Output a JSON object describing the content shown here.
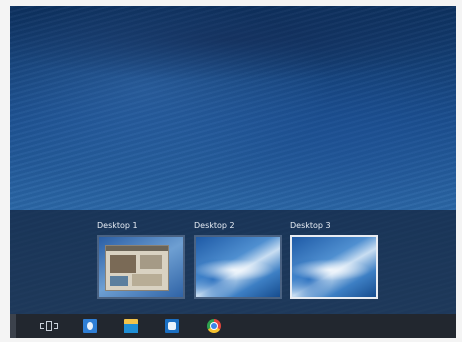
{
  "task_view": {
    "desktops": [
      {
        "label": "Desktop 1",
        "active": false
      },
      {
        "label": "Desktop 2",
        "active": false
      },
      {
        "label": "Desktop 3",
        "active": true
      }
    ]
  },
  "taskbar": {
    "icons": [
      "task-view-icon",
      "internet-explorer-icon",
      "file-explorer-icon",
      "outlook-icon",
      "chrome-icon"
    ]
  },
  "colors": {
    "taskbar": "#22272f",
    "strip": "#14233c",
    "active_border": "#e8ecf2"
  }
}
